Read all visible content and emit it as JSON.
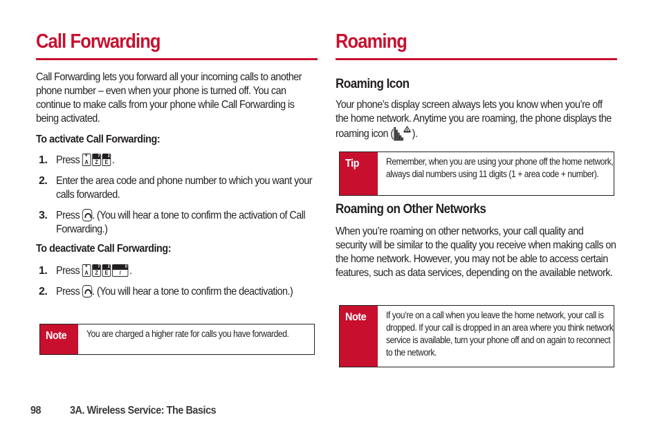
{
  "left": {
    "title": "Call Forwarding",
    "intro": "Call Forwarding lets you forward all your incoming calls to another phone number – even when your phone is turned off. You can continue to make calls from your phone while Call Forwarding is being activated.",
    "activate": {
      "heading": "To activate Call Forwarding:",
      "steps": [
        {
          "num": "1.",
          "pre": "Press",
          "keys": [
            "*/A",
            "7/Z",
            "2/E"
          ],
          "post": "."
        },
        {
          "num": "2.",
          "text": "Enter the area code and phone number to which you want your calls forwarded."
        },
        {
          "num": "3.",
          "pre": "Press",
          "key_icon": "talk-key",
          "post": ". (You will hear a tone to confirm the activation of Call Forwarding.)"
        }
      ]
    },
    "deactivate": {
      "heading": "To deactivate Call Forwarding:",
      "steps": [
        {
          "num": "1.",
          "pre": "Press",
          "keys": [
            "*/A",
            "7/Z",
            "2/E",
            "0/next"
          ],
          "post": "."
        },
        {
          "num": "2.",
          "pre": "Press",
          "key_icon": "talk-key",
          "post": ". (You will hear a tone to confirm the deactivation.)"
        }
      ]
    },
    "note": {
      "label": "Note",
      "text": "You are charged a higher rate for calls you have forwarded."
    }
  },
  "right": {
    "title": "Roaming",
    "roaming_icon": {
      "heading": "Roaming Icon",
      "text_pre": "Your phone’s display screen always lets you know when you’re off the home network. Anytime you are roaming, the phone displays the roaming icon (",
      "text_post": ")."
    },
    "tip": {
      "label": "Tip",
      "text": "Remember, when you are using your phone off the home network, always dial numbers using 11 digits (1 + area code + number)."
    },
    "other_networks": {
      "heading": "Roaming on Other Networks",
      "text": "When you’re roaming on other networks, your call quality and security will be similar to the quality you receive when making calls on the home network. However, you may not be able to access certain features, such as data services, depending on the available network."
    },
    "note": {
      "label": "Note",
      "text": "If you’re on a call when you leave the home network, your call is dropped. If your call is dropped in an area where you think network service is available, turn your phone off and on again to reconnect to the network."
    }
  },
  "footer": {
    "page_number": "98",
    "section": "3A. Wireless Service: The Basics"
  },
  "colors": {
    "accent": "#c8102e",
    "text": "#231f20"
  }
}
